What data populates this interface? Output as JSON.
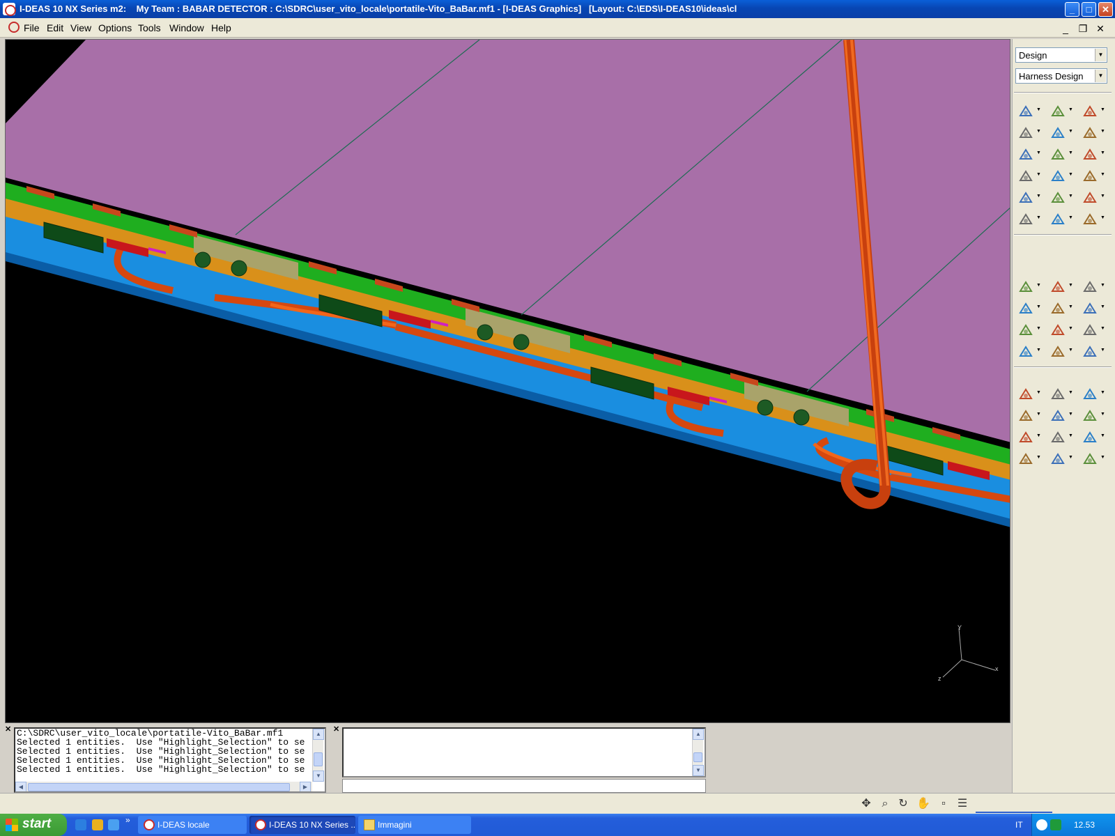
{
  "window": {
    "title": "I-DEAS 10 NX Series m2:    My Team : BABAR DETECTOR : C:\\SDRC\\user_vito_locale\\portatile-Vito_BaBar.mf1 - [I-DEAS Graphics]   [Layout: C:\\EDS\\I-DEAS10\\ideas\\cl",
    "min_glyph": "_",
    "max_glyph": "□",
    "close_glyph": "✕"
  },
  "menu": {
    "items": [
      "File",
      "Edit",
      "View",
      "Options",
      "Tools",
      "Window",
      "Help"
    ]
  },
  "mdi": {
    "min_glyph": "_",
    "restore_glyph": "❐",
    "close_glyph": "✕"
  },
  "panel": {
    "task_select": "Design",
    "app_select": "Harness Design"
  },
  "viewport": {
    "background": "#000000",
    "plane_color": "#a86fa8",
    "axis_labels": {
      "y": "Y",
      "x": "x",
      "z": "z"
    }
  },
  "log": {
    "close_glyph": "✕",
    "lines": [
      "C:\\SDRC\\user_vito_locale\\portatile-Vito_BaBar.mf1",
      "Selected 1 entities.  Use \"Highlight_Selection\" to se",
      "Selected 1 entities.  Use \"Highlight_Selection\" to se",
      "Selected 1 entities.  Use \"Highlight_Selection\" to se",
      "Selected 1 entities.  Use \"Highlight_Selection\" to se"
    ]
  },
  "output": {
    "close_glyph": "✕"
  },
  "taskbar": {
    "start_label": "start",
    "chevron": "»",
    "tasks": [
      {
        "label": "I-DEAS locale",
        "active": false
      },
      {
        "label": "I-DEAS 10 NX Series ...",
        "active": true
      },
      {
        "label": "Immagini",
        "active": false
      }
    ],
    "tray": {
      "lang": "IT",
      "clock": "12.53"
    }
  },
  "colors": {
    "titlebar": "#0a4fc4",
    "cable": "#e05a1a",
    "board_green": "#1fae1f",
    "board_orange": "#d9901a",
    "blue_panel": "#1a8ee0",
    "connector_red": "#c8161c",
    "connector_dark": "#0e4a18"
  }
}
